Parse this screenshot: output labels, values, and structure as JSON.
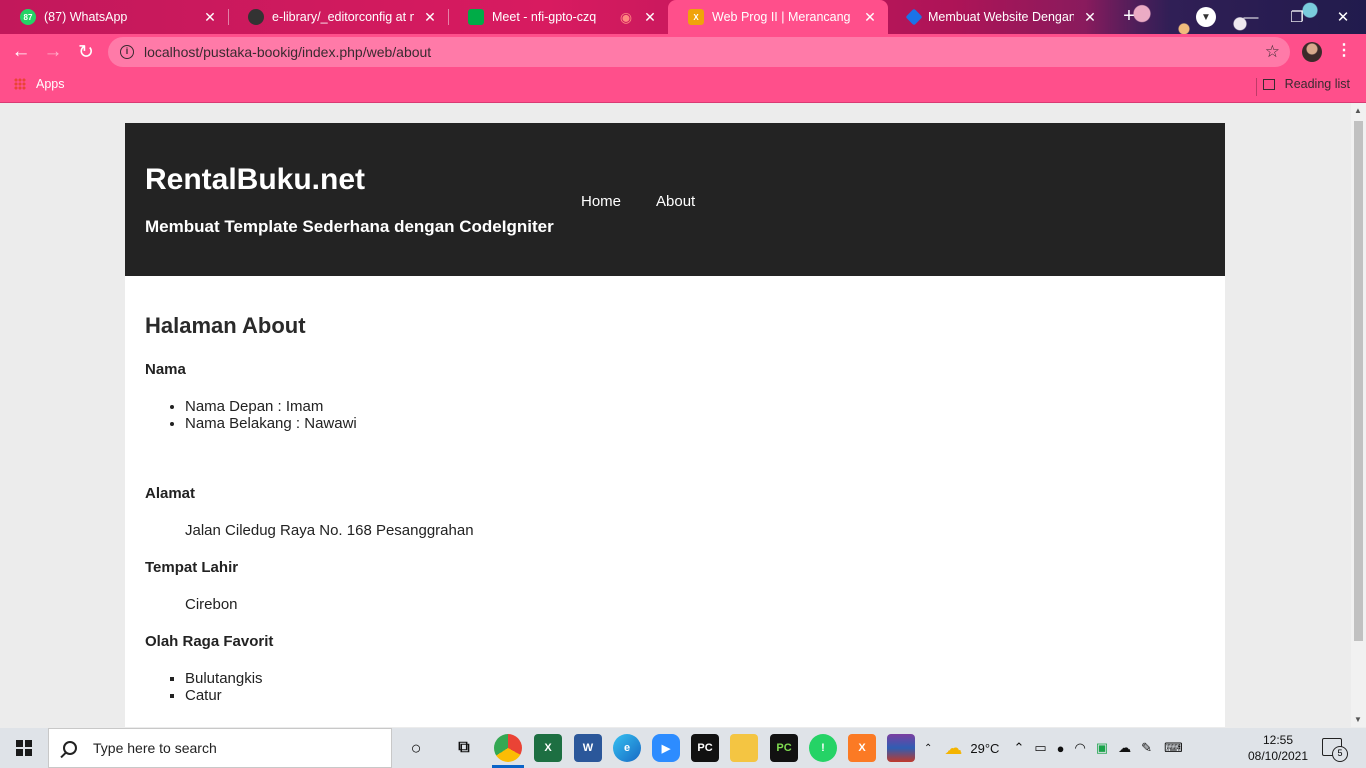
{
  "browser": {
    "tabs": [
      {
        "title": "(87) WhatsApp",
        "badge": "87",
        "color": "#25d366"
      },
      {
        "title": "e-library/_editorconfig at ma",
        "color": "#333333"
      },
      {
        "title": "Meet - nfi-gpto-czq",
        "color": "#00ac47"
      },
      {
        "title": "Web Prog II | Merancang Tem",
        "color": "#f0a30a"
      },
      {
        "title": "Membuat Website Dengan C",
        "color": "#1a73e8"
      }
    ],
    "url": "localhost/pustaka-bookig/index.php/web/about",
    "bookmarks": {
      "apps_label": "Apps",
      "reading_list_label": "Reading list"
    }
  },
  "site": {
    "title": "RentalBuku.net",
    "tagline": "Membuat Template Sederhana dengan CodeIgniter",
    "nav": [
      "Home",
      "About"
    ]
  },
  "content": {
    "heading": "Halaman About",
    "nama_label": "Nama",
    "nama_items": [
      "Nama Depan : Imam",
      "Nama Belakang : Nawawi"
    ],
    "alamat_label": "Alamat",
    "alamat_value": "Jalan Ciledug Raya No. 168 Pesanggrahan",
    "tempat_lahir_label": "Tempat Lahir",
    "tempat_lahir_value": "Cirebon",
    "olahraga_label": "Olah Raga Favorit",
    "olahraga_items": [
      "Bulutangkis",
      "Catur"
    ]
  },
  "taskbar": {
    "search_placeholder": "Type here to search",
    "temperature": "29°C",
    "time": "12:55",
    "date": "08/10/2021",
    "notification_count": "5"
  }
}
